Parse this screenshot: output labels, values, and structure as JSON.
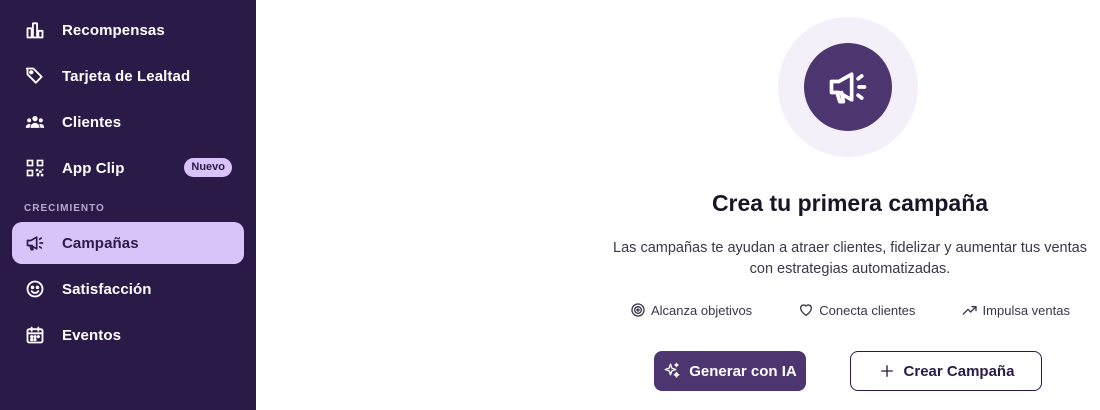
{
  "sidebar": {
    "items": [
      {
        "label": "Recompensas",
        "icon": "bar-chart-icon"
      },
      {
        "label": "Tarjeta de Lealtad",
        "icon": "tag-icon"
      },
      {
        "label": "Clientes",
        "icon": "users-icon"
      },
      {
        "label": "App Clip",
        "icon": "qr-code-icon",
        "badge": "Nuevo"
      }
    ],
    "section_label": "CRECIMIENTO",
    "growth_items": [
      {
        "label": "Campañas",
        "icon": "megaphone-icon",
        "active": true
      },
      {
        "label": "Satisfacción",
        "icon": "smile-icon"
      },
      {
        "label": "Eventos",
        "icon": "calendar-icon"
      }
    ]
  },
  "empty_state": {
    "icon": "megaphone-icon",
    "title": "Crea tu primera campaña",
    "description": "Las campañas te ayudan a atraer clientes, fidelizar y aumentar tus ventas con estrategias automatizadas.",
    "features": [
      {
        "label": "Alcanza objetivos",
        "icon": "target-icon"
      },
      {
        "label": "Conecta clientes",
        "icon": "heart-icon"
      },
      {
        "label": "Impulsa ventas",
        "icon": "trending-up-icon"
      }
    ],
    "primary_button": "Generar con IA",
    "secondary_button": "Crear Campaña"
  },
  "colors": {
    "sidebar_bg": "#2a1a47",
    "active_bg": "#d9c3fb",
    "primary": "#4d3570"
  }
}
